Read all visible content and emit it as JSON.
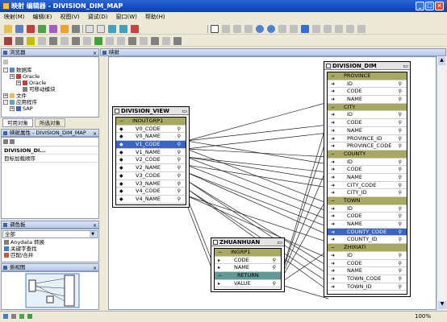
{
  "window": {
    "title": "映射 编辑器 - DIVISION_DIM_MAP"
  },
  "menu": [
    "映射(M)",
    "编辑(E)",
    "视图(V)",
    "调试(D)",
    "窗口(W)",
    "帮助(H)"
  ],
  "left": {
    "explorer": {
      "title": "浏览器",
      "items": [
        {
          "label": "数据库",
          "level": 0,
          "expander": "-"
        },
        {
          "label": "Oracle",
          "level": 1,
          "expander": "+"
        },
        {
          "label": "Oracle",
          "level": 2,
          "expander": "+"
        },
        {
          "label": "可移动模块",
          "level": 2,
          "expander": ""
        },
        {
          "label": "文件",
          "level": 0,
          "expander": "+"
        },
        {
          "label": "应用程序",
          "level": 0,
          "expander": "-"
        },
        {
          "label": "SAP",
          "level": 1,
          "expander": "+"
        }
      ],
      "tabs": [
        "可用对象",
        "所选对象"
      ]
    },
    "props": {
      "title": "映射属性 - DIVISION_DIM_MAP",
      "items": [
        "DIVISION_DI...",
        "目标加载顺序"
      ]
    },
    "palette": {
      "title": "调色板",
      "dropdown": "全部",
      "items": [
        "Anydata 转换",
        "关键字查找",
        "匹配/合并"
      ]
    },
    "birdseye": {
      "title": "俯视图"
    }
  },
  "canvas": {
    "title": "映射"
  },
  "tables": {
    "division_view": {
      "title": "DIVISION_VIEW",
      "group": "INOUTGRP1",
      "rows": [
        "V0_CODE",
        "V0_NAME",
        "V1_CODE",
        "V1_NAME",
        "V2_CODE",
        "V2_NAME",
        "V3_CODE",
        "V3_NAME",
        "V4_CODE",
        "V4_NAME"
      ]
    },
    "zhuanhuan": {
      "title": "ZHUANHUAN",
      "group": "INGRP1",
      "rows": [
        "CODE",
        "NAME"
      ],
      "group2": "RETURN",
      "rows2": [
        "VALUE"
      ]
    },
    "division_dim": {
      "title": "DIVISION_DIM",
      "groups": [
        {
          "name": "PROVINCE",
          "rows": [
            "ID",
            "CODE",
            "NAME"
          ]
        },
        {
          "name": "CITY",
          "rows": [
            "ID",
            "CODE",
            "NAME",
            "PROVINCE_ID",
            "PROVINCE_CODE"
          ]
        },
        {
          "name": "COUNTY",
          "rows": [
            "ID",
            "CODE",
            "NAME",
            "CITY_CODE",
            "CITY_ID"
          ]
        },
        {
          "name": "TOWN",
          "rows": [
            "ID",
            "CODE",
            "NAME",
            "COUNTY_CODE",
            "COUNTY_ID"
          ]
        },
        {
          "name": "ZHIXIATI",
          "rows": [
            "ID",
            "CODE",
            "NAME",
            "TOWN_CODE",
            "TOWN_ID"
          ]
        }
      ]
    }
  },
  "status": {
    "zoom": "100%"
  }
}
